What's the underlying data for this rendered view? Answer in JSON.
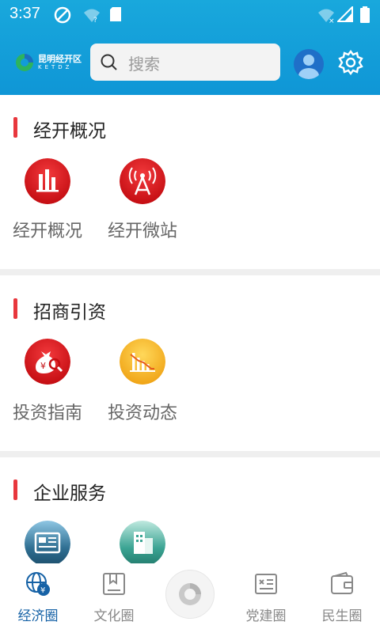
{
  "status_bar": {
    "time": "3:37"
  },
  "header": {
    "logo_name": "昆明经开区",
    "logo_sub": "KETDZ",
    "search_placeholder": "搜索"
  },
  "sections": [
    {
      "title": "经开概况",
      "tiles": [
        {
          "label": "经开概况",
          "icon": "bar-chart-icon"
        },
        {
          "label": "经开微站",
          "icon": "broadcast-tower-icon"
        }
      ]
    },
    {
      "title": "招商引资",
      "tiles": [
        {
          "label": "投资指南",
          "icon": "money-bag-search-icon"
        },
        {
          "label": "投资动态",
          "icon": "trend-chart-icon"
        }
      ]
    },
    {
      "title": "企业服务",
      "tiles": [
        {
          "label": "",
          "icon": "newspaper-icon"
        },
        {
          "label": "",
          "icon": "building-icon"
        }
      ]
    }
  ],
  "tabbar": {
    "tabs": [
      {
        "label": "经济圈",
        "icon": "globe-yuan-icon",
        "active": true
      },
      {
        "label": "文化圈",
        "icon": "bookmark-book-icon",
        "active": false
      },
      {
        "label": "",
        "icon": "center-logo-icon",
        "active": false
      },
      {
        "label": "党建圈",
        "icon": "party-board-icon",
        "active": false
      },
      {
        "label": "民生圈",
        "icon": "wallet-icon",
        "active": false
      }
    ]
  },
  "colors": {
    "header": "#0f96d6",
    "accent": "#e8373d",
    "active_tab": "#1662a6"
  }
}
